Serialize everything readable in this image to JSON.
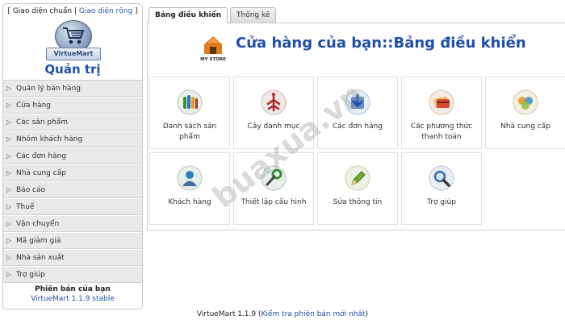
{
  "sidebar": {
    "view_bracket_open": "[",
    "view_standard": "Giao diện chuẩn",
    "view_separator": "|",
    "view_wide": "Giao diện rộng",
    "view_bracket_close": "]",
    "logo_text": "VirtueMart",
    "admin_title": "Quản trị",
    "menu": [
      {
        "label": "Quản lý bán hàng"
      },
      {
        "label": "Cửa hàng"
      },
      {
        "label": "Các sản phẩm"
      },
      {
        "label": "Nhóm khách hàng"
      },
      {
        "label": "Các đơn hàng"
      },
      {
        "label": "Nhà cung cấp"
      },
      {
        "label": "Báo cáo"
      },
      {
        "label": "Thuế"
      },
      {
        "label": "Vận chuyển"
      },
      {
        "label": "Mã giảm giá"
      },
      {
        "label": "Nhà sản xuất"
      },
      {
        "label": "Trợ giúp"
      }
    ],
    "version_title": "Phiên bản của bạn",
    "version_value": "VirtueMart 1.1.9 stable"
  },
  "tabs": [
    {
      "label": "Bảng điều khiển",
      "active": true
    },
    {
      "label": "Thống kê",
      "active": false
    }
  ],
  "header": {
    "store_icon_text": "MY STORE",
    "title": "Cửa hàng của bạn::Bảng điều khiển"
  },
  "tiles": [
    {
      "label": "Danh sách sản phẩm",
      "icon": "product-list-icon"
    },
    {
      "label": "Cây danh mục",
      "icon": "category-tree-icon"
    },
    {
      "label": "Các đơn hàng",
      "icon": "orders-icon"
    },
    {
      "label": "Các phương thức thanh toán",
      "icon": "payment-methods-icon"
    },
    {
      "label": "Nhà cung cấp",
      "icon": "vendors-icon"
    },
    {
      "label": "Khách hàng",
      "icon": "customer-icon"
    },
    {
      "label": "Thiết lập cấu hình",
      "icon": "configuration-icon"
    },
    {
      "label": "Sửa thông tin",
      "icon": "edit-info-icon"
    },
    {
      "label": "Trợ giúp",
      "icon": "help-icon"
    }
  ],
  "footer": {
    "version": "VirtueMart 1.1.9",
    "open_paren": "(",
    "check_link": "Kiểm tra phiên bản mới nhất",
    "close_paren": ")"
  },
  "watermark": "buaxua.vn",
  "colors": {
    "accent": "#1f4fa8",
    "menu_bg": "#e9e9e9"
  }
}
